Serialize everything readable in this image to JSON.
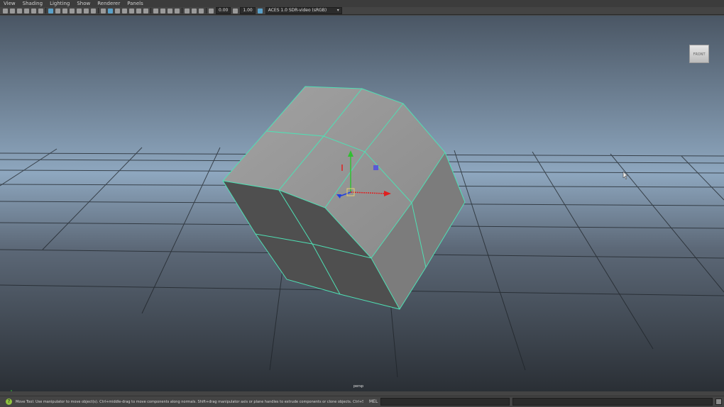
{
  "menubar": {
    "items": [
      "View",
      "Shading",
      "Lighting",
      "Show",
      "Renderer",
      "Panels"
    ]
  },
  "toolbar": {
    "exposure_value": "0.00",
    "gamma_value": "1.00",
    "color_space": "ACES 1.0 SDR-video (sRGB)"
  },
  "viewport": {
    "camera_label": "persp",
    "view_cube_label": "FRONT"
  },
  "status": {
    "help_text": "Move Tool: Use manipulator to move object(s). Ctrl+middle-drag to move components along normals. Shift+drag manipulator axis or plane handles to extrude components or clone objects. Ctrl+Shift+drag to c",
    "mel_label": "MEL"
  },
  "colors": {
    "wireframe_highlight": "#4fe0b4",
    "sky_top": "#4a5664",
    "sky_horizon": "#8ea7bf",
    "ground_near": "#2a2f35",
    "manipulator_x": "#e02020",
    "manipulator_y": "#30c030",
    "manipulator_z": "#2040e0"
  }
}
